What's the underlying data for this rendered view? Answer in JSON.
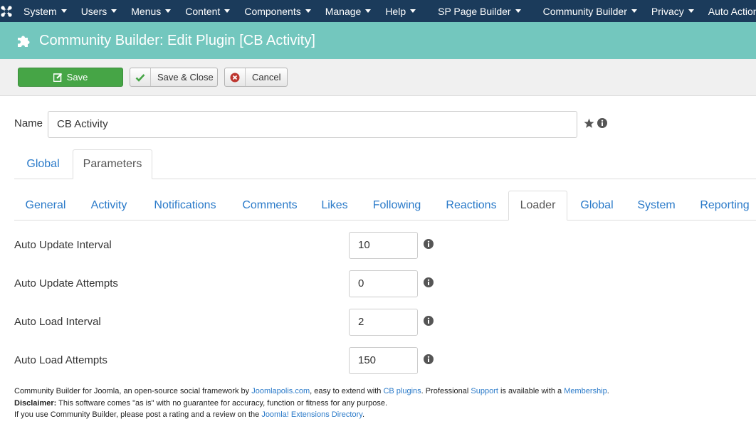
{
  "navbar": {
    "items": [
      {
        "label": "System"
      },
      {
        "label": "Users"
      },
      {
        "label": "Menus"
      },
      {
        "label": "Content"
      },
      {
        "label": "Components"
      },
      {
        "label": "Manage"
      },
      {
        "label": "Help"
      },
      {
        "label": "SP Page Builder"
      },
      {
        "label": "Community Builder"
      },
      {
        "label": "Privacy"
      },
      {
        "label": "Auto Actions"
      }
    ]
  },
  "header": {
    "title": "Community Builder: Edit Plugin [CB Activity]",
    "icon": "puzzle-icon"
  },
  "toolbar": {
    "save_label": "Save",
    "save_close_label": "Save & Close",
    "cancel_label": "Cancel"
  },
  "name": {
    "label": "Name",
    "value": "CB Activity"
  },
  "main_tabs": [
    {
      "label": "Global",
      "active": false
    },
    {
      "label": "Parameters",
      "active": true
    }
  ],
  "sub_tabs": [
    {
      "label": "General"
    },
    {
      "label": "Activity"
    },
    {
      "label": "Notifications"
    },
    {
      "label": "Comments"
    },
    {
      "label": "Likes"
    },
    {
      "label": "Following"
    },
    {
      "label": "Reactions"
    },
    {
      "label": "Loader"
    },
    {
      "label": "Global"
    },
    {
      "label": "System"
    },
    {
      "label": "Reporting"
    }
  ],
  "fields": [
    {
      "label": "Auto Update Interval",
      "value": "10"
    },
    {
      "label": "Auto Update Attempts",
      "value": "0"
    },
    {
      "label": "Auto Load Interval",
      "value": "2"
    },
    {
      "label": "Auto Load Attempts",
      "value": "150"
    }
  ],
  "footer": {
    "line1_a": "Community Builder for Joomla, an open-source social framework by ",
    "link_joomlapolis": "Joomlapolis.com",
    "line1_b": ", easy to extend with ",
    "link_plugins": "CB plugins",
    "line1_c": ". Professional ",
    "link_support": "Support",
    "line1_d": " is available with a ",
    "link_membership": "Membership",
    "line1_e": ".",
    "disclaimer_label": "Disclaimer:",
    "disclaimer_text": " This software comes \"as is\" with no guarantee for accuracy, function or fitness for any purpose.",
    "line3_a": "If you use Community Builder, please post a rating and a review on the ",
    "link_jed": "Joomla! Extensions Directory",
    "line3_b": "."
  },
  "colors": {
    "navbar": "#1b3b5b",
    "header": "#73c7be",
    "save_button": "#46a546",
    "link": "#2a7ac9"
  }
}
